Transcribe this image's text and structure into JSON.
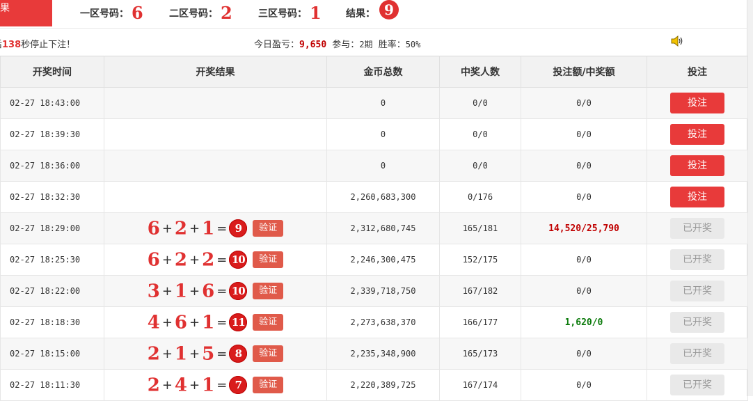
{
  "top": {
    "tab_label": "果",
    "zone1_label": "一区号码：",
    "zone1_value": "6",
    "zone2_label": "二区号码：",
    "zone2_value": "2",
    "zone3_label": "三区号码：",
    "zone3_value": "1",
    "result_label": "结果：",
    "result_value": "9"
  },
  "info": {
    "countdown_prefix": "后",
    "countdown_seconds": "138",
    "countdown_suffix": "秒停止下注！",
    "profit_label": "今日盈亏：",
    "profit_value": "9,650",
    "participate_label": "参与：",
    "participate_value": "2期",
    "winrate_label": "胜率：",
    "winrate_value": "50%",
    "speaker_icon": "speaker-icon"
  },
  "table": {
    "headers": [
      "开奖时间",
      "开奖结果",
      "金币总数",
      "中奖人数",
      "投注额/中奖额",
      "投注"
    ],
    "rows": [
      {
        "time": "02-27 18:43:00",
        "result": null,
        "coins": "0",
        "winners": "0/0",
        "bet_win": "0/0",
        "action": "投注"
      },
      {
        "time": "02-27 18:39:30",
        "result": null,
        "coins": "0",
        "winners": "0/0",
        "bet_win": "0/0",
        "action": "投注"
      },
      {
        "time": "02-27 18:36:00",
        "result": null,
        "coins": "0",
        "winners": "0/0",
        "bet_win": "0/0",
        "action": "投注"
      },
      {
        "time": "02-27 18:32:30",
        "result": null,
        "coins": "2,260,683,300",
        "winners": "0/176",
        "bet_win": "0/0",
        "action": "投注"
      },
      {
        "time": "02-27 18:29:00",
        "result": {
          "a": "6",
          "b": "2",
          "c": "1",
          "sum": "9"
        },
        "coins": "2,312,680,745",
        "winners": "165/181",
        "bet_win": "14,520/25,790",
        "bet_win_style": "red",
        "action": "已开奖"
      },
      {
        "time": "02-27 18:25:30",
        "result": {
          "a": "6",
          "b": "2",
          "c": "2",
          "sum": "10"
        },
        "coins": "2,246,300,475",
        "winners": "152/175",
        "bet_win": "0/0",
        "action": "已开奖"
      },
      {
        "time": "02-27 18:22:00",
        "result": {
          "a": "3",
          "b": "1",
          "c": "6",
          "sum": "10"
        },
        "coins": "2,339,718,750",
        "winners": "167/182",
        "bet_win": "0/0",
        "action": "已开奖"
      },
      {
        "time": "02-27 18:18:30",
        "result": {
          "a": "4",
          "b": "6",
          "c": "1",
          "sum": "11"
        },
        "coins": "2,273,638,370",
        "winners": "166/177",
        "bet_win": "1,620/0",
        "bet_win_style": "green",
        "action": "已开奖"
      },
      {
        "time": "02-27 18:15:00",
        "result": {
          "a": "2",
          "b": "1",
          "c": "5",
          "sum": "8"
        },
        "coins": "2,235,348,900",
        "winners": "165/173",
        "bet_win": "0/0",
        "action": "已开奖"
      },
      {
        "time": "02-27 18:11:30",
        "result": {
          "a": "2",
          "b": "4",
          "c": "1",
          "sum": "7"
        },
        "coins": "2,220,389,725",
        "winners": "167/174",
        "bet_win": "0/0",
        "action": "已开奖"
      }
    ],
    "verify_label": "验证",
    "plus_sign": "+",
    "equals_sign": "="
  },
  "colors": {
    "accent": "#e83a3a",
    "number_red": "#e03131",
    "win_green": "#0a7a0a",
    "header_bg": "#f2f2f2"
  }
}
